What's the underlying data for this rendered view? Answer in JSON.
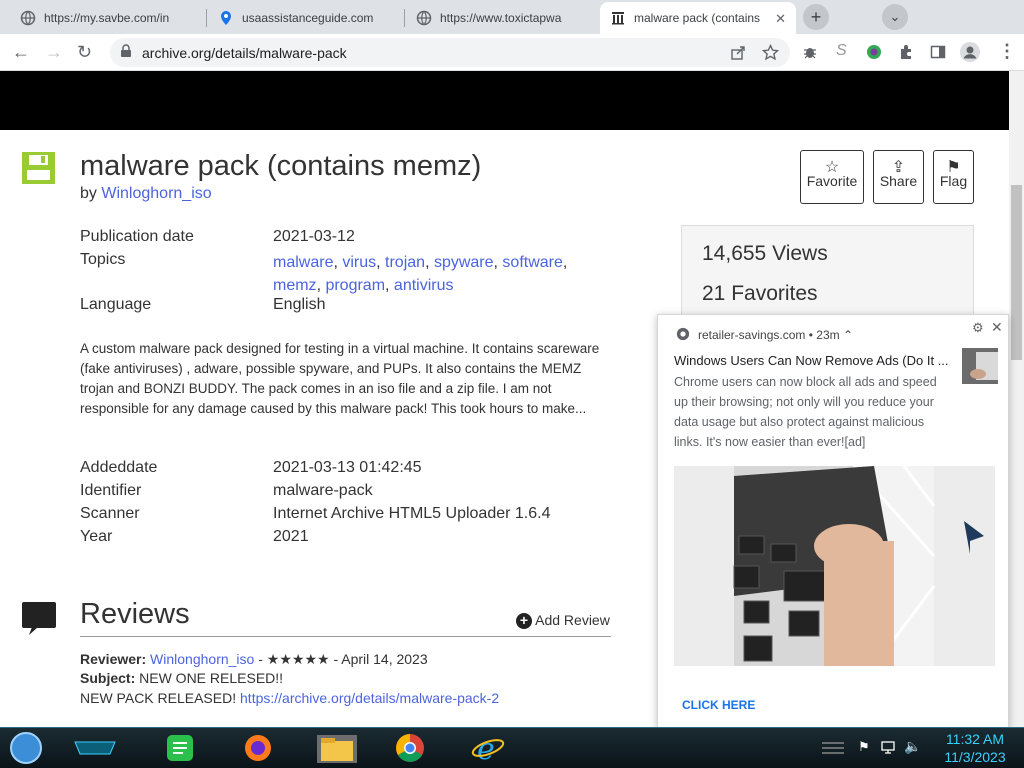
{
  "browser": {
    "tabs": [
      {
        "title": "https://my.savbe.com/in",
        "icon": "globe-icon"
      },
      {
        "title": "usaassistanceguide.com",
        "icon": "location-pin-icon"
      },
      {
        "title": "https://www.toxictapwa",
        "icon": "globe-icon"
      },
      {
        "title": "malware pack (contains m",
        "icon": "archive-icon",
        "active": true
      }
    ],
    "url": "archive.org/details/malware-pack"
  },
  "item": {
    "title": "malware pack (contains memz)",
    "by_prefix": "by",
    "author": "Winloghorn_iso",
    "actions": {
      "favorite": "Favorite",
      "share": "Share",
      "flag": "Flag"
    },
    "meta": {
      "pubdate_label": "Publication date",
      "pubdate": "2021-03-12",
      "topics_label": "Topics",
      "topics": [
        "malware",
        "virus",
        "trojan",
        "spyware",
        "software",
        "memz",
        "program",
        "antivirus"
      ],
      "language_label": "Language",
      "language": "English"
    },
    "description": "A custom malware pack designed for testing in a virtual machine. It contains scareware (fake antiviruses) , adware, possible spyware, and PUPs. It also contains the MEMZ trojan and BONZI BUDDY. The pack comes in an iso file and a zip file. I am not responsible for any damage caused by this malware pack! This took hours to make...",
    "details": {
      "addeddate_label": "Addeddate",
      "addeddate": "2021-03-13 01:42:45",
      "identifier_label": "Identifier",
      "identifier": "malware-pack",
      "scanner_label": "Scanner",
      "scanner": "Internet Archive HTML5 Uploader 1.6.4",
      "year_label": "Year",
      "year": "2021"
    },
    "stats": {
      "views": "14,655 Views",
      "favorites": "21 Favorites"
    }
  },
  "reviews": {
    "heading": "Reviews",
    "add_label": "Add Review",
    "reviewer_label": "Reviewer:",
    "reviewer": "Winlonghorn_iso",
    "stars": "★★★★★",
    "date": "- April 14, 2023",
    "subject_label": "Subject:",
    "subject": "NEW ONE RELESED!!",
    "body": "NEW PACK RELEASED!",
    "link": "https://archive.org/details/malware-pack-2"
  },
  "notification": {
    "source": "retailer-savings.com",
    "age": "23m",
    "title": "Windows Users Can Now Remove Ads (Do It ...",
    "body": "Chrome users can now block all ads and speed up their browsing; not only will you reduce your data usage but also protect against malicious links. It's now easier than ever![ad]",
    "cta": "CLICK HERE"
  },
  "taskbar": {
    "time": "11:32 AM",
    "date": "11/3/2023"
  }
}
